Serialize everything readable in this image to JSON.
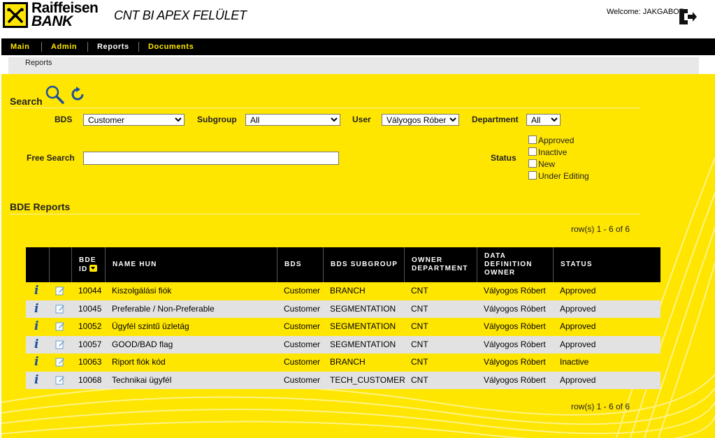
{
  "brand": {
    "line1": "Raiffeisen",
    "line2": "BANK"
  },
  "app_title": "CNT BI APEX FELÜLET",
  "welcome": "Welcome: JAKGABOR",
  "nav": [
    "Main",
    "Admin",
    "Reports",
    "Documents"
  ],
  "breadcrumb": "Reports",
  "search": {
    "title": "Search",
    "bds_label": "BDS",
    "bds_value": "Customer",
    "subgroup_label": "Subgroup",
    "subgroup_value": "All",
    "user_label": "User",
    "user_value": "Vályogos Róbert",
    "department_label": "Department",
    "department_value": "All",
    "free_search_label": "Free Search",
    "free_search_value": "",
    "status_label": "Status",
    "status_options": [
      "Approved",
      "Inactive",
      "New",
      "Under Editing"
    ]
  },
  "reports": {
    "title": "BDE Reports",
    "row_count": "row(s) 1 - 6 of 6",
    "columns": [
      "",
      "",
      "BDE ID",
      "NAME HUN",
      "BDS",
      "BDS SUBGROUP",
      "OWNER DEPARTMENT",
      "DATA DEFINITION OWNER",
      "STATUS"
    ],
    "rows": [
      {
        "id": "10044",
        "name": "Kiszolgálási fiók",
        "bds": "Customer",
        "subgroup": "BRANCH",
        "dept": "CNT",
        "owner": "Vályogos Róbert",
        "status": "Approved"
      },
      {
        "id": "10045",
        "name": "Preferable / Non-Preferable",
        "bds": "Customer",
        "subgroup": "SEGMENTATION",
        "dept": "CNT",
        "owner": "Vályogos Róbert",
        "status": "Approved"
      },
      {
        "id": "10052",
        "name": "Ügyfél szintű üzletág",
        "bds": "Customer",
        "subgroup": "SEGMENTATION",
        "dept": "CNT",
        "owner": "Vályogos Róbert",
        "status": "Approved"
      },
      {
        "id": "10057",
        "name": "GOOD/BAD flag",
        "bds": "Customer",
        "subgroup": "SEGMENTATION",
        "dept": "CNT",
        "owner": "Vályogos Róbert",
        "status": "Approved"
      },
      {
        "id": "10063",
        "name": "Riport fiók kód",
        "bds": "Customer",
        "subgroup": "BRANCH",
        "dept": "CNT",
        "owner": "Vályogos Róbert",
        "status": "Inactive"
      },
      {
        "id": "10068",
        "name": "Technikai ügyfél",
        "bds": "Customer",
        "subgroup": "TECH_CUSTOMER",
        "dept": "CNT",
        "owner": "Vályogos Róbert",
        "status": "Approved"
      }
    ]
  },
  "icons": {
    "logo": "raiffeisen-cross-logo",
    "logout": "logout-icon",
    "search": "magnifier-icon",
    "reset": "refresh-icon",
    "info": "info-icon",
    "edit": "edit-icon",
    "sort": "sort-desc-icon"
  },
  "colors": {
    "accent": "#ffe600",
    "nav_bg": "#000000",
    "row_alt": "#e2e2e2",
    "info_blue": "#1a4fa0"
  }
}
